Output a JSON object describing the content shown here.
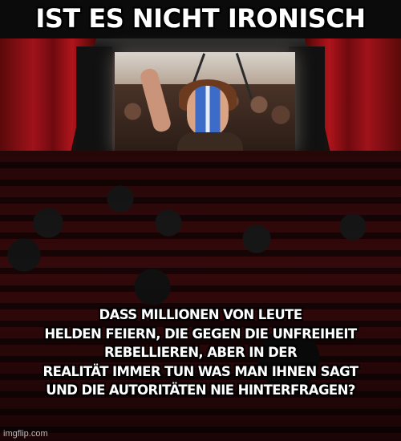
{
  "meme": {
    "top_text": "IST ES NICHT IRONISCH",
    "bottom_text": "DASS MILLIONEN VON LEUTE\nHELDEN FEIERN, DIE GEGEN DIE UNFREIHEIT\nREBELLIEREN, ABER IN DER\nREALITÄT IMMER TUN WAS MAN IHNEN SAGT\nUND DIE AUTORITÄTEN NIE HINTERFRAGEN?",
    "watermark": "imgflip.com"
  }
}
